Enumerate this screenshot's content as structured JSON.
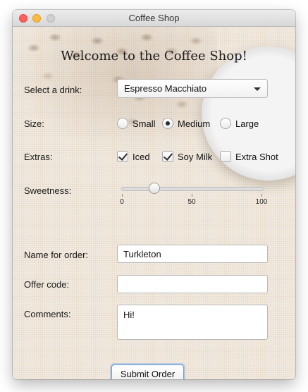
{
  "window": {
    "title": "Coffee Shop"
  },
  "header": {
    "welcome": "Welcome to the Coffee Shop!"
  },
  "form": {
    "drink": {
      "label": "Select a drink:",
      "selected": "Espresso Macchiato"
    },
    "size": {
      "label": "Size:",
      "options": [
        "Small",
        "Medium",
        "Large"
      ],
      "selected": "Medium"
    },
    "extras": {
      "label": "Extras:",
      "items": [
        {
          "label": "Iced",
          "checked": true
        },
        {
          "label": "Soy Milk",
          "checked": true
        },
        {
          "label": "Extra Shot",
          "checked": false
        }
      ]
    },
    "sweetness": {
      "label": "Sweetness:",
      "min": 0,
      "max": 100,
      "value": 23,
      "tick_labels": [
        "0",
        "50",
        "100"
      ]
    },
    "name": {
      "label": "Name for order:",
      "value": "Turkleton"
    },
    "offer_code": {
      "label": "Offer code:",
      "value": ""
    },
    "comments": {
      "label": "Comments:",
      "value": "Hi!"
    },
    "submit_label": "Submit Order"
  },
  "colors": {
    "focus_ring": "#6aa0d8",
    "background": "#f2ebe1"
  }
}
